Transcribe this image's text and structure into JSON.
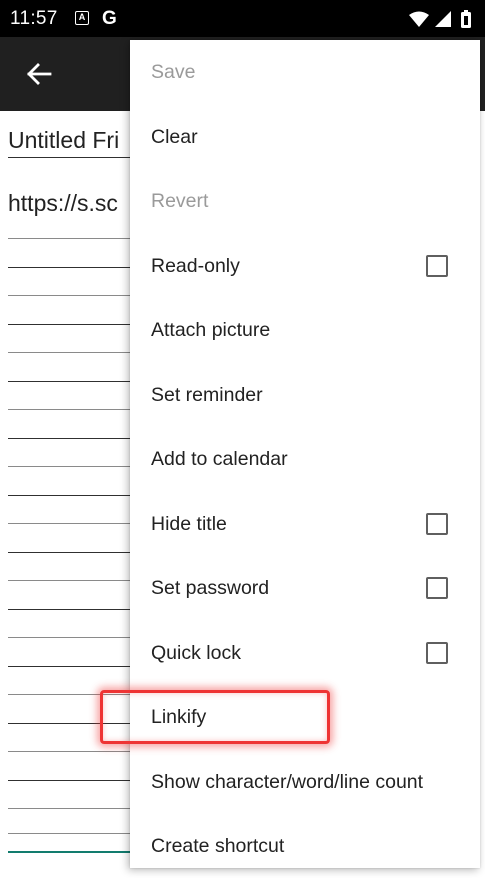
{
  "status_bar": {
    "time": "11:57",
    "notification_icons": [
      "a-icon",
      "google-g-icon"
    ],
    "g_label": "G",
    "system_icons": [
      "wifi-icon",
      "cell-signal-icon",
      "battery-icon"
    ]
  },
  "app_bar": {
    "back_icon": "arrow-back-icon"
  },
  "note": {
    "title": "Untitled Fri",
    "text": "https://s.sc"
  },
  "menu": {
    "items": [
      {
        "label": "Save",
        "enabled": false,
        "checkbox": false
      },
      {
        "label": "Clear",
        "enabled": true,
        "checkbox": false
      },
      {
        "label": "Revert",
        "enabled": false,
        "checkbox": false
      },
      {
        "label": "Read-only",
        "enabled": true,
        "checkbox": true,
        "checked": false
      },
      {
        "label": "Attach picture",
        "enabled": true,
        "checkbox": false
      },
      {
        "label": "Set reminder",
        "enabled": true,
        "checkbox": false
      },
      {
        "label": "Add to calendar",
        "enabled": true,
        "checkbox": false
      },
      {
        "label": "Hide title",
        "enabled": true,
        "checkbox": true,
        "checked": false
      },
      {
        "label": "Set password",
        "enabled": true,
        "checkbox": true,
        "checked": false
      },
      {
        "label": "Quick lock",
        "enabled": true,
        "checkbox": true,
        "checked": false
      },
      {
        "label": "Linkify",
        "enabled": true,
        "checkbox": false,
        "highlighted": true
      },
      {
        "label": "Show character/word/line count",
        "enabled": true,
        "checkbox": false
      },
      {
        "label": "Create shortcut",
        "enabled": true,
        "checkbox": false
      }
    ]
  },
  "colors": {
    "status_bar": "#000000",
    "app_bar": "#202020",
    "highlight": "#ee3434",
    "disabled_text": "#9a9a9a",
    "teal_line": "#127c6e"
  }
}
